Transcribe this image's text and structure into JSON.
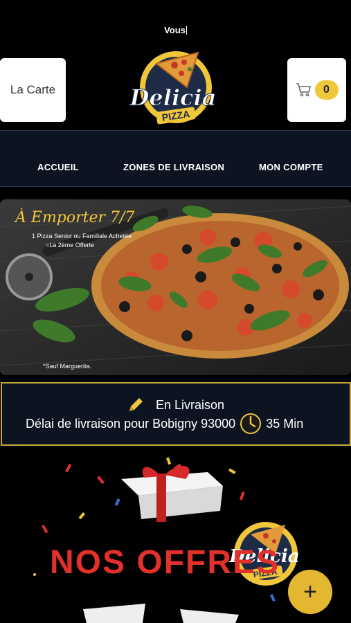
{
  "status": {
    "text": "Vous"
  },
  "header": {
    "menu_label": "La Carte",
    "cart_count": "0",
    "logo_text_main": "Delicia",
    "logo_text_sub": "PIZZA"
  },
  "nav": {
    "items": [
      {
        "label": "ACCUEIL"
      },
      {
        "label": "ZONES DE LIVRAISON"
      },
      {
        "label": "MON COMPTE"
      }
    ]
  },
  "banner": {
    "title": "À Emporter 7/7",
    "line1": "1 Pizza Senior ou Familiale Achetée",
    "line2": "=La 2ème Offerte",
    "note": "*Sauf Marguerita."
  },
  "delivery": {
    "mode": "En Livraison",
    "label": "Délai de livraison pour Bobigny 93000",
    "time": "35 Min"
  },
  "offers": {
    "title": "NOS OFFRES"
  },
  "fab": {
    "label": "+"
  },
  "colors": {
    "accent": "#f0c63a",
    "navy": "#0c1422",
    "red": "#e2302b"
  },
  "icons": [
    "cart-icon",
    "pencil-icon",
    "clock-icon",
    "plus-icon",
    "pizza-logo"
  ]
}
